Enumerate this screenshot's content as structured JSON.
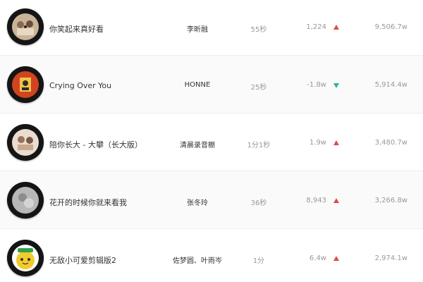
{
  "rows": [
    {
      "title": "你笑起来真好看",
      "artist": "李昕融",
      "duration": "55秒",
      "change": "1,224",
      "trend": "up",
      "plays": "9,506.7w",
      "cover_icon": "photo-cover-icon"
    },
    {
      "title": "Crying Over You",
      "artist": "HONNE",
      "duration": "25秒",
      "change": "-1.8w",
      "trend": "down",
      "plays": "5,914.4w",
      "cover_icon": "orange-cover-icon"
    },
    {
      "title": "陪你长大 - 大攀（长大版）",
      "artist": "清晨录音棚",
      "duration": "1分1秒",
      "change": "1.9w",
      "trend": "up",
      "plays": "3,480.7w",
      "cover_icon": "photo-cover-icon"
    },
    {
      "title": "花开的时候你就来看我",
      "artist": "张冬玲",
      "duration": "36秒",
      "change": "8,943",
      "trend": "up",
      "plays": "3,266.8w",
      "cover_icon": "gray-cover-icon"
    },
    {
      "title": "无敌小可爱剪辑版2",
      "artist": "佐梦圆、叶雨岑",
      "duration": "1分",
      "change": "6.4w",
      "trend": "up",
      "plays": "2,974.1w",
      "cover_icon": "yellow-cartoon-cover-icon"
    }
  ],
  "colors": {
    "trend_up": "#e04a4a",
    "trend_down": "#2bb3a0"
  }
}
